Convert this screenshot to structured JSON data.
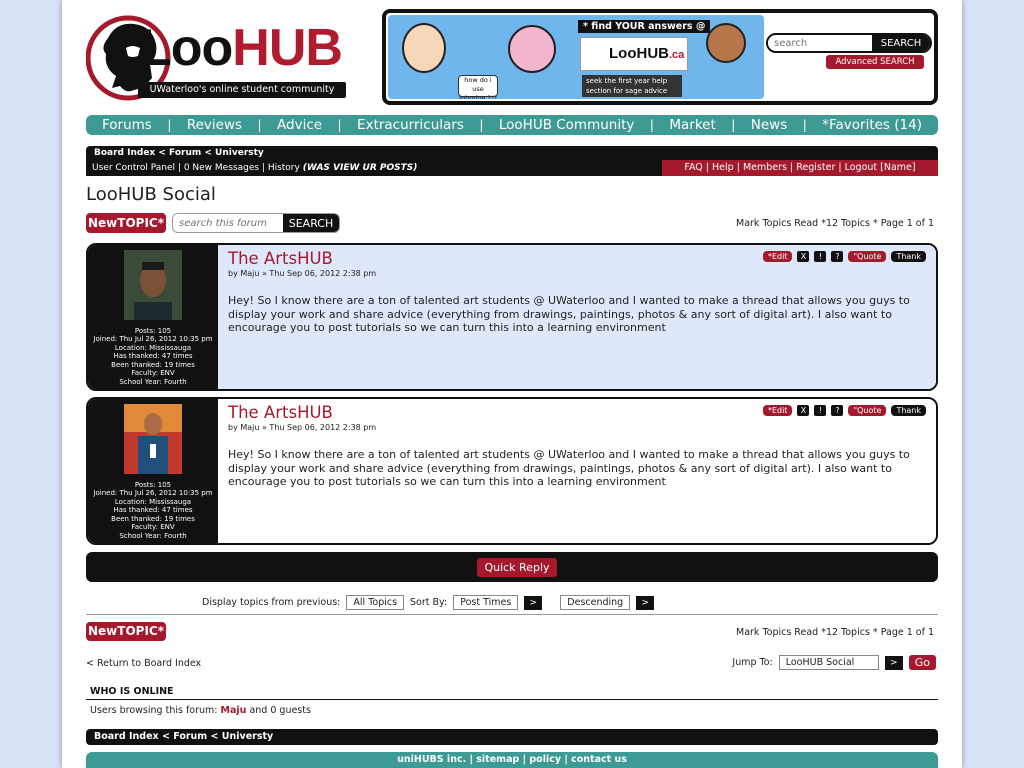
{
  "colors": {
    "brand_red": "#a41a2c",
    "teal": "#3d9a94",
    "black": "#111111",
    "post_bg": "#dfe8fb",
    "page_bg": "#d9e3f7"
  },
  "logo": {
    "loo": "Loo",
    "hub": "HUB",
    "tagline": "UWaterloo's online student community"
  },
  "banner": {
    "tag": "* find YOUR answers @",
    "logo_loo": "LooHUB",
    "logo_ca": ".ca",
    "help_text": "seek the first year help section for sage advice",
    "bubble_text": "how do i use Jobmine ?!?"
  },
  "header_search": {
    "placeholder": "search",
    "button": "SEARCH",
    "advanced": "Advanced SEARCH"
  },
  "nav": [
    "Forums",
    "Reviews",
    "Advice",
    "Extracurriculars",
    "LooHUB Community",
    "Market",
    "News",
    "*Favorites (14)"
  ],
  "breadcrumb": "Board Index < Forum < Universty",
  "ucp": {
    "left": [
      "User Control Panel",
      "0 New Messages",
      "History"
    ],
    "history_note": "(WAS VIEW UR POSTS)",
    "right": [
      "FAQ",
      "Help",
      "Members",
      "Register",
      "Logout [Name]"
    ]
  },
  "forum_title": "LooHUB Social",
  "new_topic": "NewTOPIC*",
  "forum_search": {
    "placeholder": "search this forum",
    "button": "SEARCH"
  },
  "page_info": "Mark Topics Read *12 Topics * Page 1 of 1",
  "posts": [
    {
      "title": "The ArtsHUB",
      "meta": "by Maju » Thu Sep 06, 2012 2:38 pm",
      "text": "Hey! So I know there are a ton of talented art students @ UWaterloo and I wanted to make a thread that allows you guys to display your work and share advice (everything from drawings, paintings, photos & any sort of digital art). I also want to encourage you to post tutorials so we can turn this into a learning environment",
      "stats": [
        "Posts: 105",
        "Joined: Thu Jul 26, 2012 10:35 pm",
        "Location: Mississauga",
        "Has thanked: 47 times",
        "Been thanked: 19 times",
        "Faculty: ENV",
        "School Year: Fourth"
      ]
    },
    {
      "title": "The ArtsHUB",
      "meta": "by Maju » Thu Sep 06, 2012 2:38 pm",
      "text": "Hey! So I know there are a ton of talented art students @ UWaterloo and I wanted to make a thread that allows you guys to display your work and share advice (everything from drawings, paintings, photos & any sort of digital art). I also want to encourage you to post tutorials so we can turn this into a learning environment",
      "stats": [
        "Posts: 105",
        "Joined: Thu Jul 26, 2012 10:35 pm",
        "Location: Mississauga",
        "Has thanked: 47 times",
        "Been thanked: 19 times",
        "Faculty: ENV",
        "School Year: Fourth"
      ]
    }
  ],
  "post_actions": {
    "edit": "*Edit",
    "x": "X",
    "warn": "!",
    "info": "?",
    "quote": "\"Quote",
    "thank": "Thank"
  },
  "quick_reply": "Quick Reply",
  "display": {
    "label": "Display topics from previous:",
    "topics": "All Topics",
    "sort_label": "Sort By:",
    "sort": "Post Times",
    "order": "Descending",
    "arrow": ">"
  },
  "return_link": "< Return to Board Index",
  "jump": {
    "label": "Jump To:",
    "value": "LooHUB Social",
    "arrow": ">",
    "go": "Go"
  },
  "who_online": {
    "title": "WHO IS ONLINE",
    "prefix": "Users browsing this forum:",
    "user": "Maju",
    "suffix": "and 0 guests"
  },
  "footer": "uniHUBS inc. | sitemap | policy | contact us"
}
